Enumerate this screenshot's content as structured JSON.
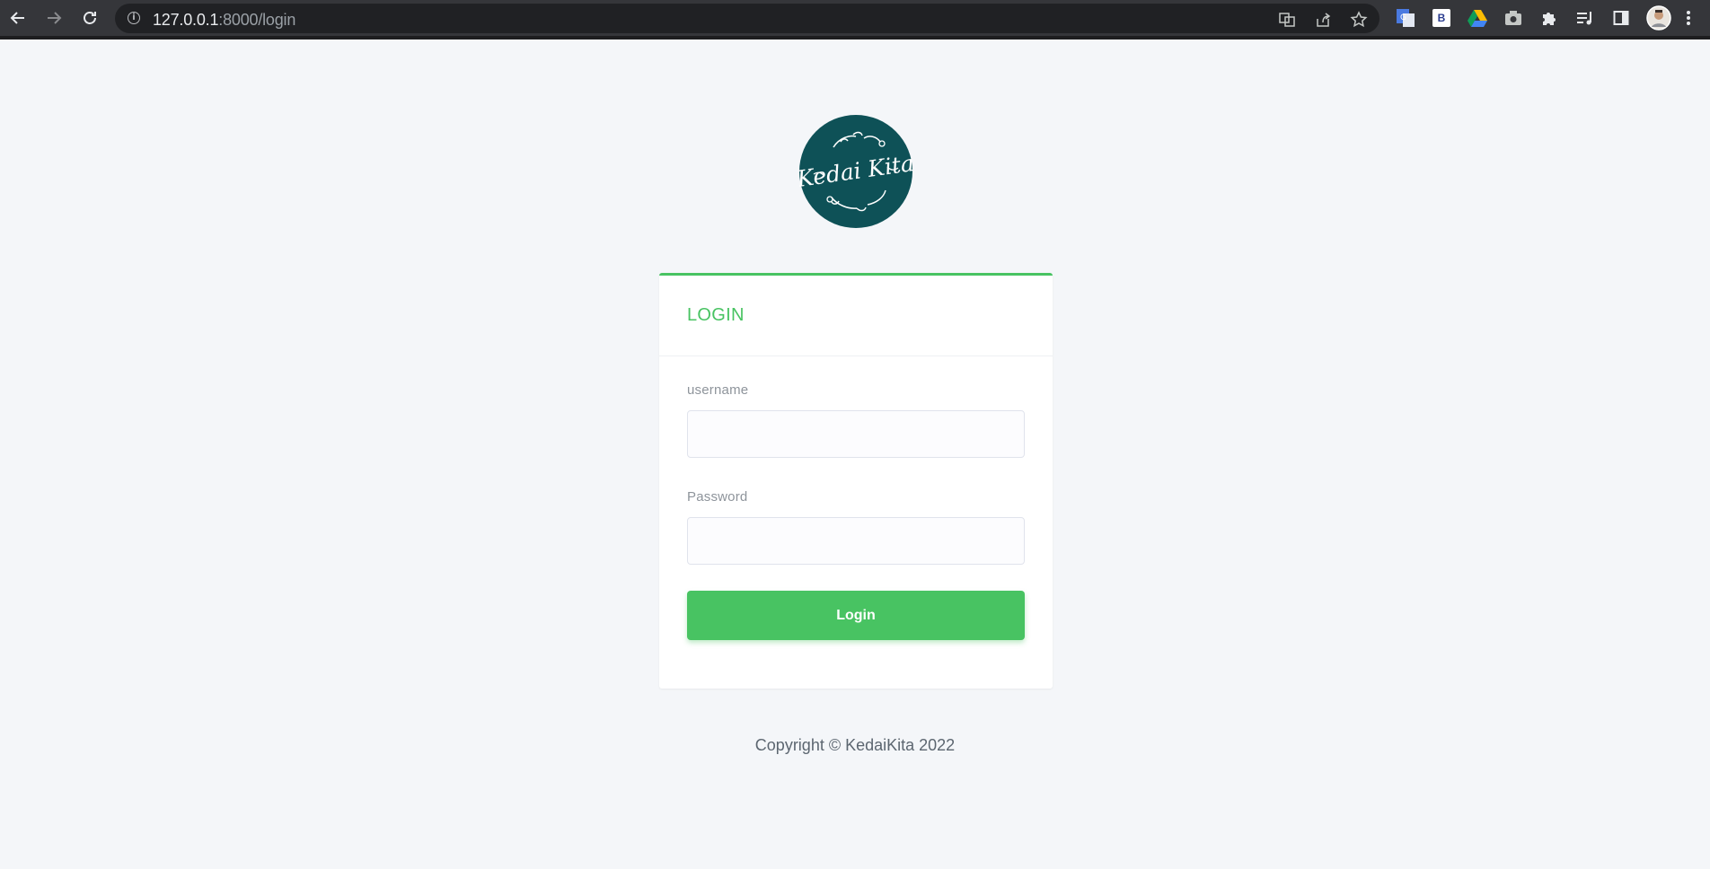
{
  "browser": {
    "url_host": "127.0.0.1",
    "url_rest": ":8000/login",
    "extension_b_label": "B"
  },
  "colors": {
    "accent": "#48c362",
    "logo_bg": "#0e5157"
  },
  "logo": {
    "text": "Kedai Kita"
  },
  "login_card": {
    "title": "LOGIN",
    "username_label": "username",
    "username_value": "",
    "password_label": "Password",
    "password_value": "",
    "submit_label": "Login"
  },
  "footer": {
    "copyright": "Copyright © KedaiKita 2022"
  }
}
